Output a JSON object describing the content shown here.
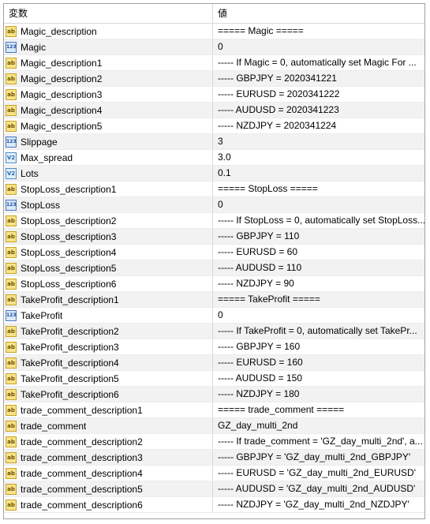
{
  "header": {
    "col_name": "変数",
    "col_value": "値"
  },
  "rows": [
    {
      "icon": "string-icon",
      "glyph": "ab",
      "name": "Magic_description",
      "value": " ===== Magic ====="
    },
    {
      "icon": "integer-icon",
      "glyph": "123",
      "name": "Magic",
      "value": "0"
    },
    {
      "icon": "string-icon",
      "glyph": "ab",
      "name": "Magic_description1",
      "value": "----- If Magic = 0, automatically set Magic For ..."
    },
    {
      "icon": "string-icon",
      "glyph": "ab",
      "name": "Magic_description2",
      "value": "----- GBPJPY = 2020341221"
    },
    {
      "icon": "string-icon",
      "glyph": "ab",
      "name": "Magic_description3",
      "value": "----- EURUSD = 2020341222"
    },
    {
      "icon": "string-icon",
      "glyph": "ab",
      "name": "Magic_description4",
      "value": "----- AUDUSD = 2020341223"
    },
    {
      "icon": "string-icon",
      "glyph": "ab",
      "name": "Magic_description5",
      "value": "----- NZDJPY = 2020341224"
    },
    {
      "icon": "integer-icon",
      "glyph": "123",
      "name": "Slippage",
      "value": "3"
    },
    {
      "icon": "double-icon",
      "glyph": "V2",
      "name": "Max_spread",
      "value": "3.0"
    },
    {
      "icon": "double-icon",
      "glyph": "V2",
      "name": "Lots",
      "value": "0.1"
    },
    {
      "icon": "string-icon",
      "glyph": "ab",
      "name": "StopLoss_description1",
      "value": " ===== StopLoss ====="
    },
    {
      "icon": "integer-icon",
      "glyph": "123",
      "name": "StopLoss",
      "value": "0"
    },
    {
      "icon": "string-icon",
      "glyph": "ab",
      "name": "StopLoss_description2",
      "value": "----- If StopLoss = 0, automatically set StopLoss..."
    },
    {
      "icon": "string-icon",
      "glyph": "ab",
      "name": "StopLoss_description3",
      "value": "----- GBPJPY = 110"
    },
    {
      "icon": "string-icon",
      "glyph": "ab",
      "name": "StopLoss_description4",
      "value": "----- EURUSD = 60"
    },
    {
      "icon": "string-icon",
      "glyph": "ab",
      "name": "StopLoss_description5",
      "value": "----- AUDUSD = 110"
    },
    {
      "icon": "string-icon",
      "glyph": "ab",
      "name": "StopLoss_description6",
      "value": "----- NZDJPY = 90"
    },
    {
      "icon": "string-icon",
      "glyph": "ab",
      "name": "TakeProfit_description1",
      "value": " ===== TakeProfit ====="
    },
    {
      "icon": "integer-icon",
      "glyph": "123",
      "name": "TakeProfit",
      "value": "0"
    },
    {
      "icon": "string-icon",
      "glyph": "ab",
      "name": "TakeProfit_description2",
      "value": "----- If TakeProfit = 0, automatically set TakePr..."
    },
    {
      "icon": "string-icon",
      "glyph": "ab",
      "name": "TakeProfit_description3",
      "value": "----- GBPJPY = 160"
    },
    {
      "icon": "string-icon",
      "glyph": "ab",
      "name": "TakeProfit_description4",
      "value": "----- EURUSD = 160"
    },
    {
      "icon": "string-icon",
      "glyph": "ab",
      "name": "TakeProfit_description5",
      "value": "----- AUDUSD = 150"
    },
    {
      "icon": "string-icon",
      "glyph": "ab",
      "name": "TakeProfit_description6",
      "value": "----- NZDJPY = 180"
    },
    {
      "icon": "string-icon",
      "glyph": "ab",
      "name": "trade_comment_description1",
      "value": " ===== trade_comment ====="
    },
    {
      "icon": "string-icon",
      "glyph": "ab",
      "name": "trade_comment",
      "value": "GZ_day_multi_2nd"
    },
    {
      "icon": "string-icon",
      "glyph": "ab",
      "name": "trade_comment_description2",
      "value": "----- If trade_comment = 'GZ_day_multi_2nd', a..."
    },
    {
      "icon": "string-icon",
      "glyph": "ab",
      "name": "trade_comment_description3",
      "value": "----- GBPJPY = 'GZ_day_multi_2nd_GBPJPY'"
    },
    {
      "icon": "string-icon",
      "glyph": "ab",
      "name": "trade_comment_description4",
      "value": "----- EURUSD = 'GZ_day_multi_2nd_EURUSD'"
    },
    {
      "icon": "string-icon",
      "glyph": "ab",
      "name": "trade_comment_description5",
      "value": "----- AUDUSD = 'GZ_day_multi_2nd_AUDUSD'"
    },
    {
      "icon": "string-icon",
      "glyph": "ab",
      "name": "trade_comment_description6",
      "value": "----- NZDJPY = 'GZ_day_multi_2nd_NZDJPY'"
    }
  ]
}
